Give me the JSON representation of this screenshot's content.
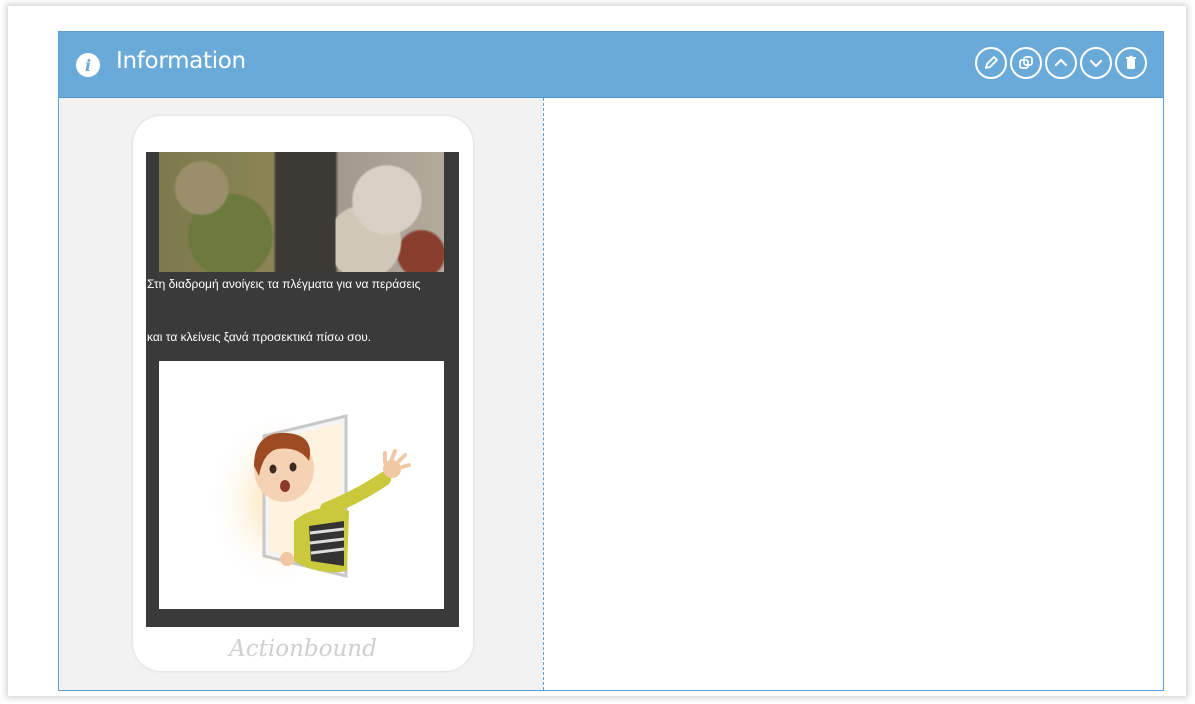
{
  "panel": {
    "title": "Information",
    "icon": "info-icon",
    "header_color": "#6aaad9",
    "toolbar": [
      {
        "icon": "pencil-icon"
      },
      {
        "icon": "copy-icon"
      },
      {
        "icon": "chevron-up-icon"
      },
      {
        "icon": "chevron-down-icon"
      },
      {
        "icon": "trash-icon"
      }
    ]
  },
  "preview": {
    "caption_line1": "Στη διαδρομή ανοίγεις τα πλέγματα για να περάσεις",
    "caption_line2": "και τα κλείνεις ξανά προσεκτικά πίσω σου.",
    "brand": "Actionbound"
  }
}
